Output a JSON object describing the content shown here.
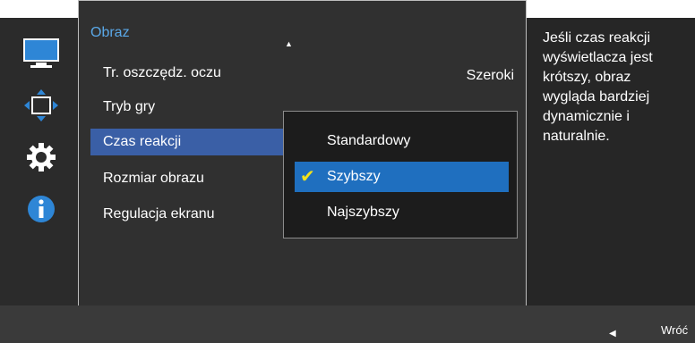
{
  "menu": {
    "title": "Obraz",
    "items": [
      {
        "label": "Tr. oszczędz. oczu",
        "value": "Szeroki"
      },
      {
        "label": "Tryb gry"
      },
      {
        "label": "Czas reakcji"
      },
      {
        "label": "Rozmiar obrazu"
      },
      {
        "label": "Regulacja ekranu"
      }
    ]
  },
  "dropdown": {
    "options": [
      "Standardowy",
      "Szybszy",
      "Najszybszy"
    ],
    "selected": "Szybszy"
  },
  "description": "Jeśli czas reakcji wyświetlacza jest krótszy, obraz wygląda bardziej dynamicznie i naturalnie.",
  "footer": {
    "back_label": "Wróć"
  },
  "icons": {
    "monitor": "monitor-icon",
    "resize": "resize-icon",
    "settings": "gear-icon",
    "info": "info-icon"
  },
  "colors": {
    "accent_blue": "#3a5fa6",
    "selected_option": "#1f6fbf",
    "title_blue": "#5aa8e8",
    "check_yellow": "#f2e21b"
  }
}
